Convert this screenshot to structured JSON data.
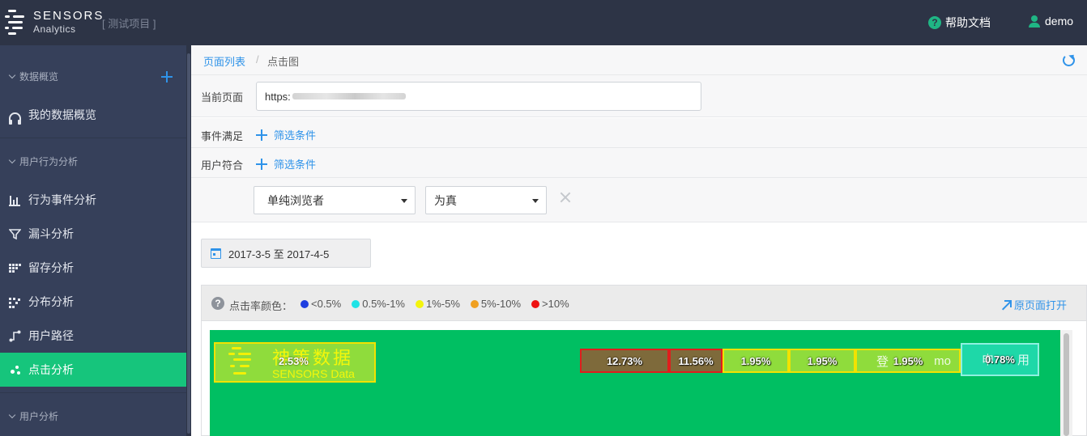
{
  "header": {
    "brand_name": "SENSORS",
    "brand_sub": "Analytics",
    "project": "[ 测试项目 ]",
    "help_label": "帮助文档",
    "user_name": "demo"
  },
  "sidebar": {
    "groups": [
      {
        "title": "数据概览",
        "items": [
          {
            "label": "我的数据概览",
            "icon": "headset-icon"
          }
        ]
      },
      {
        "title": "用户行为分析",
        "items": [
          {
            "label": "行为事件分析",
            "icon": "bar-chart-icon"
          },
          {
            "label": "漏斗分析",
            "icon": "funnel-icon"
          },
          {
            "label": "留存分析",
            "icon": "retention-icon"
          },
          {
            "label": "分布分析",
            "icon": "distribution-icon"
          },
          {
            "label": "用户路径",
            "icon": "path-icon"
          },
          {
            "label": "点击分析",
            "icon": "click-icon",
            "active": true
          }
        ]
      },
      {
        "title": "用户分析",
        "items": []
      }
    ]
  },
  "breadcrumb": {
    "parent": "页面列表",
    "separator": "/",
    "current": "点击图"
  },
  "filters": {
    "current_page_label": "当前页面",
    "current_page_url_visible": "https:",
    "event_label": "事件满足",
    "event_add": "筛选条件",
    "user_label": "用户符合",
    "user_add": "筛选条件",
    "condition_property": "单纯浏览者",
    "condition_operator": "为真"
  },
  "date_range": "2017-3-5 至 2017-4-5",
  "legend": {
    "title": "点击率颜色：",
    "items": [
      {
        "label": "<0.5%",
        "color": "#1f3fe0"
      },
      {
        "label": "0.5%-1%",
        "color": "#1ee3e6"
      },
      {
        "label": "1%-5%",
        "color": "#f4f40c"
      },
      {
        "label": "5%-10%",
        "color": "#f0a020"
      },
      {
        "label": ">10%",
        "color": "#ee1111"
      }
    ],
    "open_original": "原页面打开"
  },
  "heatmap": {
    "background": "#00bf62",
    "logo": {
      "cn": "神策数据",
      "en": "SENSORS Data",
      "pct": "2.53%"
    },
    "hotspots": [
      {
        "pct": "12.73%",
        "under": "",
        "fill": "#7e6a3b",
        "border": "#e01d1d"
      },
      {
        "pct": "11.56%",
        "under": "",
        "fill": "#7e6a3b",
        "border": "#e01d1d"
      },
      {
        "pct": "1.95%",
        "under": "",
        "fill": "#8fdc3c",
        "border": "#f1e200"
      },
      {
        "pct": "1.95%",
        "under": "",
        "fill": "#8fdc3c",
        "border": "#f1e200"
      },
      {
        "pct": "1.95%",
        "under": "登",
        "under2": "mo",
        "fill": "#8fdc3c",
        "border": "#f1e200"
      },
      {
        "pct": "0.78%",
        "under": "申",
        "under2": "用",
        "fill": "#1ed8a8",
        "border": "#8ff0e0"
      }
    ]
  }
}
